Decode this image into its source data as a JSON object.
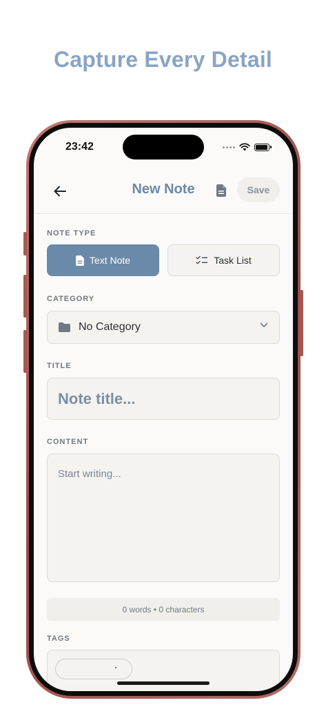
{
  "headline": "Capture Every Detail",
  "status_bar": {
    "time": "23:42"
  },
  "header": {
    "title": "New Note",
    "save_label": "Save"
  },
  "note_type": {
    "label": "NOTE TYPE",
    "options": [
      {
        "label": "Text Note",
        "icon": "document-icon",
        "selected": true
      },
      {
        "label": "Task List",
        "icon": "checklist-icon",
        "selected": false
      }
    ]
  },
  "category": {
    "label": "CATEGORY",
    "value": "No Category"
  },
  "title_field": {
    "label": "TITLE",
    "placeholder": "Note title..."
  },
  "content_field": {
    "label": "CONTENT",
    "placeholder": "Start writing..."
  },
  "counter": "0 words • 0 characters",
  "tags": {
    "label": "TAGS"
  },
  "colors": {
    "accent": "#6b89a8",
    "headline": "#8aa4c4",
    "frame": "#b0625c",
    "background": "#fbfaf8"
  }
}
